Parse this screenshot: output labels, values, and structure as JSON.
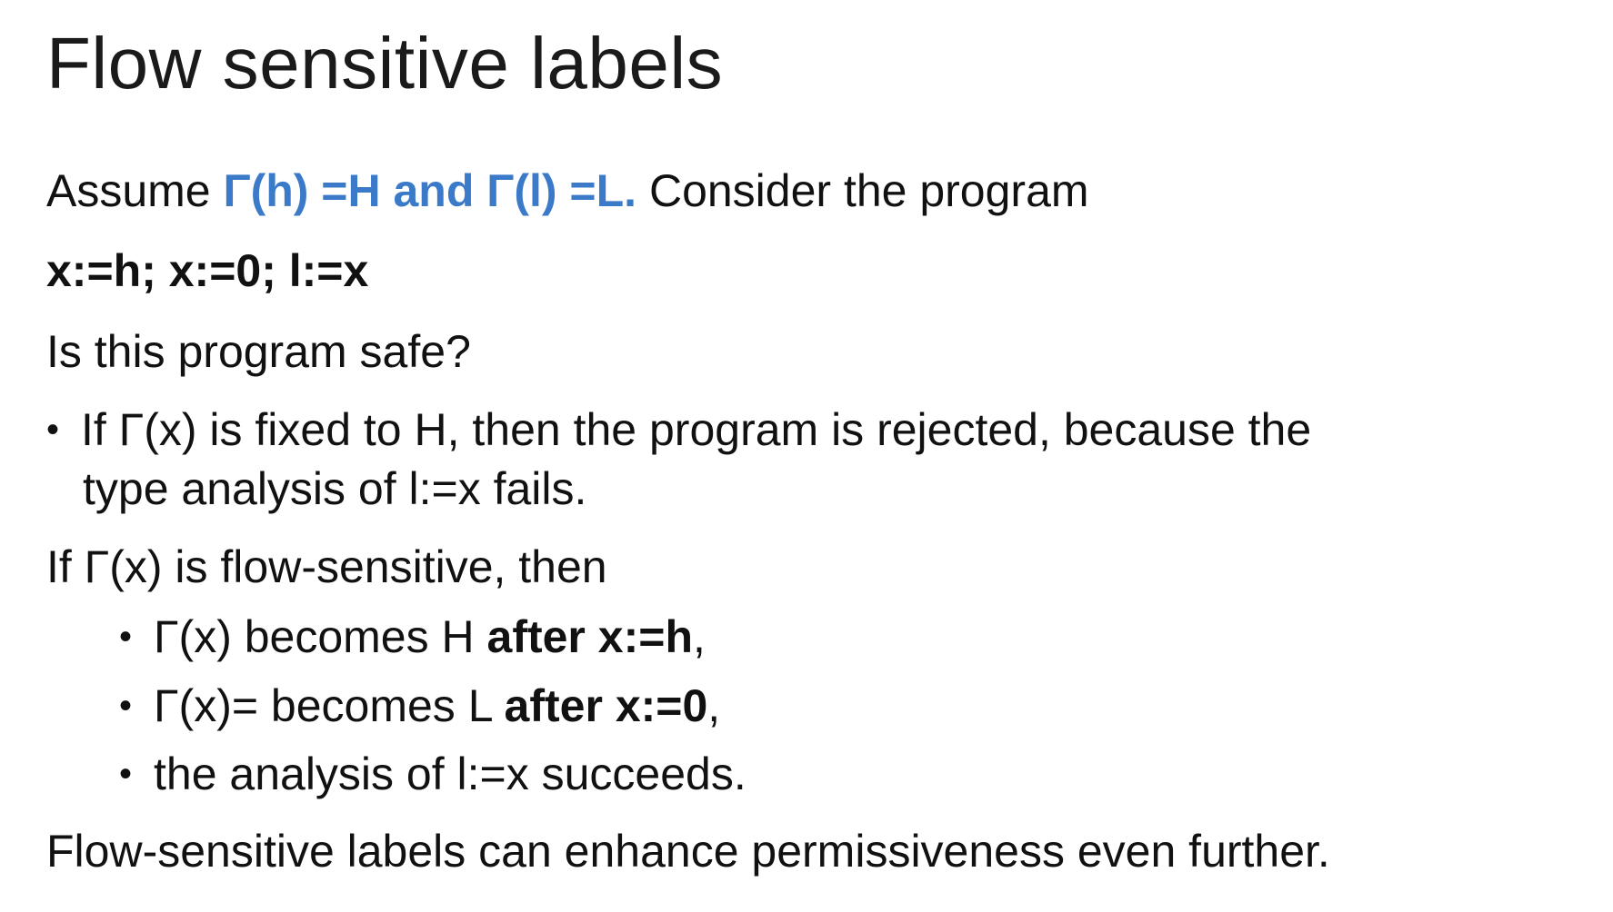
{
  "slide": {
    "title": "Flow sensitive labels",
    "assume": {
      "prefix": "Assume ",
      "highlight": "Γ(h) =H and Γ(l) =L.",
      "suffix": " Consider the program"
    },
    "program": "x:=h; x:=0; l:=x",
    "question": "Is this program safe?",
    "fixed_bullet": {
      "bullet_glyph": "•",
      "line1": "If Γ(x) is fixed to H, then the program is rejected, because the",
      "line2": "type analysis of l:=x fails."
    },
    "flow_intro": "If Γ(x) is flow-sensitive, then",
    "sub_bullets": [
      {
        "bullet_glyph": "•",
        "text": "Γ(x) becomes H ",
        "bold": "after x:=h",
        "tail": ","
      },
      {
        "bullet_glyph": "•",
        "text": "Γ(x)= becomes L ",
        "bold": "after x:=0",
        "tail": ","
      },
      {
        "bullet_glyph": "•",
        "text": "the analysis of l:=x succeeds.",
        "bold": "",
        "tail": ""
      }
    ],
    "closing": "Flow-sensitive labels can enhance permissiveness even further."
  },
  "colors": {
    "accent": "#3a7ac8",
    "text": "#111111",
    "background": "#ffffff"
  }
}
